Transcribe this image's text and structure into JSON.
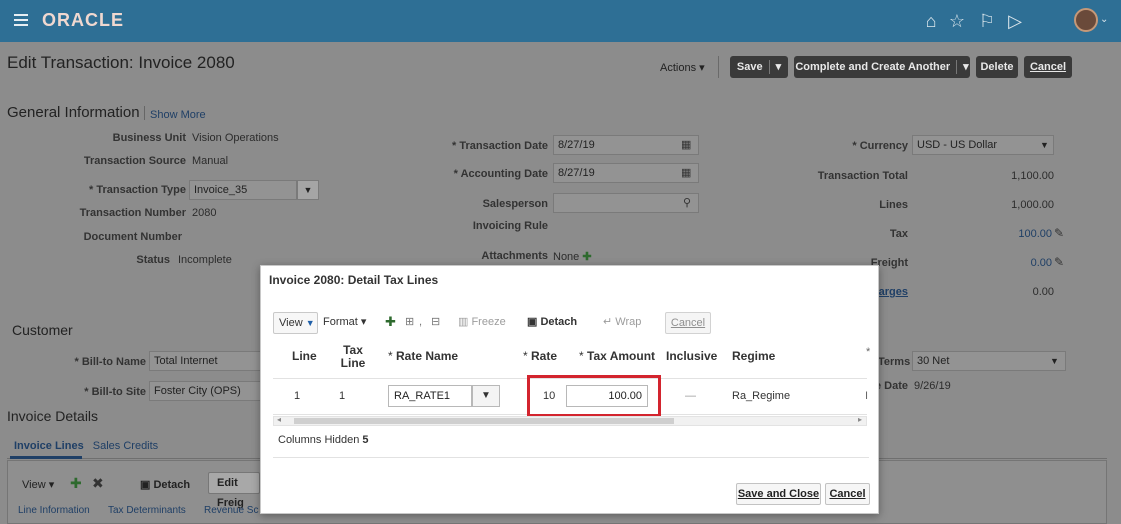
{
  "header": {
    "logo": "ORACLE",
    "icons": [
      "home-icon",
      "star-icon",
      "flag-icon",
      "play-icon"
    ]
  },
  "page": {
    "title": "Edit Transaction: Invoice 2080",
    "actions_label": "Actions",
    "save_label": "Save",
    "complete_label": "Complete and Create Another",
    "delete_label": "Delete",
    "cancel_label": "Cancel"
  },
  "general": {
    "title": "General Information",
    "show_more": "Show More",
    "business_unit_label": "Business Unit",
    "business_unit": "Vision Operations",
    "transaction_source_label": "Transaction Source",
    "transaction_source": "Manual",
    "transaction_type_label": "Transaction Type",
    "transaction_type": "Invoice_35",
    "transaction_number_label": "Transaction Number",
    "transaction_number": "2080",
    "document_number_label": "Document Number",
    "status_label": "Status",
    "status": "Incomplete",
    "transaction_date_label": "Transaction Date",
    "transaction_date": "8/27/19",
    "accounting_date_label": "Accounting Date",
    "accounting_date": "8/27/19",
    "salesperson_label": "Salesperson",
    "invoicing_rule_label": "Invoicing Rule",
    "attachments_label": "Attachments",
    "attachments_value": "None",
    "currency_label": "Currency",
    "currency": "USD - US Dollar",
    "transaction_total_label": "Transaction Total",
    "transaction_total": "1,100.00",
    "lines_label": "Lines",
    "lines": "1,000.00",
    "tax_label": "Tax",
    "tax": "100.00",
    "freight_label_partial": "Freight",
    "freight": "0.00",
    "charges_label_partial": "harges",
    "charges": "0.00"
  },
  "customer": {
    "title": "Customer",
    "bill_to_name_label": "Bill-to Name",
    "bill_to_name": "Total Internet",
    "bill_to_site_label": "Bill-to Site",
    "bill_to_site": "Foster City (OPS)",
    "terms_label": "Terms",
    "terms": "30 Net",
    "due_date_label_partial": "e Date",
    "due_date": "9/26/19"
  },
  "invoice_details": {
    "title": "Invoice Details",
    "tabs": [
      "Invoice Lines",
      "Sales Credits"
    ],
    "toolbar_view": "View",
    "toolbar_detach": "Detach",
    "toolbar_edit_partial": "Edit Freig",
    "subtabs": [
      "Line Information",
      "Tax Determinants",
      "Revenue Sc"
    ]
  },
  "dialog": {
    "title": "Invoice 2080: Detail Tax Lines",
    "toolbar": {
      "view": "View",
      "format": "Format",
      "freeze": "Freeze",
      "detach": "Detach",
      "wrap": "Wrap",
      "cancel": "Cancel"
    },
    "columns": {
      "line": "Line",
      "tax_line": "Tax Line",
      "rate_name": "Rate Name",
      "rate": "Rate",
      "tax_amount": "Tax Amount",
      "inclusive": "Inclusive",
      "regime": "Regime"
    },
    "row": {
      "line": "1",
      "tax_line": "1",
      "rate_name": "RA_RATE1",
      "rate": "10",
      "tax_amount": "100.00",
      "inclusive": "—",
      "regime": "Ra_Regime"
    },
    "columns_hidden_label": "Columns Hidden",
    "columns_hidden_count": "5",
    "save_close": "Save and Close",
    "cancel": "Cancel"
  }
}
